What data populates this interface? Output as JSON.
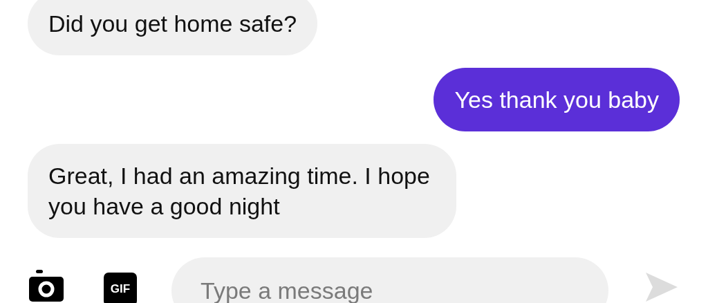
{
  "messages": [
    {
      "text": "Did you get home safe?",
      "outgoing": false
    },
    {
      "text": "Yes thank you baby",
      "outgoing": true
    },
    {
      "text": "Great, I had an amazing time. I hope you have a good night",
      "outgoing": false
    }
  ],
  "composer": {
    "gif_label": "GIF",
    "placeholder": "Type a message"
  }
}
